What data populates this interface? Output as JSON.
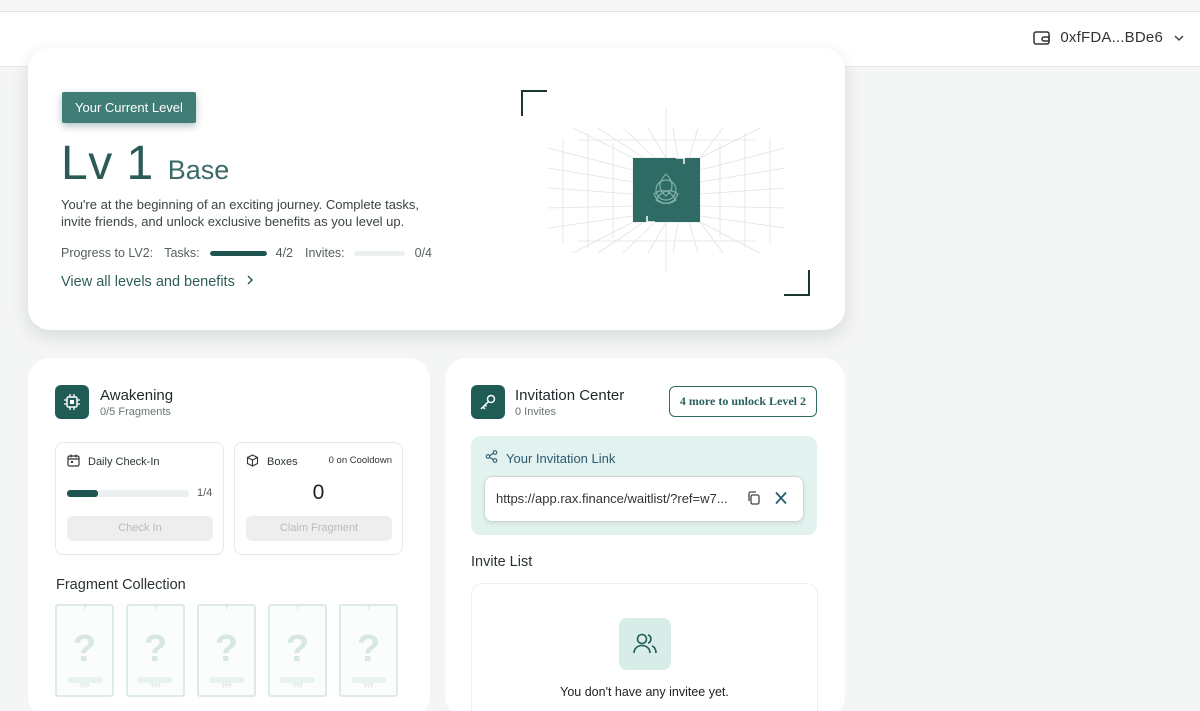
{
  "header": {
    "wallet_address": "0xfFDA...BDe6"
  },
  "level": {
    "badge": "Your Current Level",
    "number": "Lv 1",
    "name": "Base",
    "description": "You're at the beginning of an exciting journey. Complete tasks, invite friends, and unlock exclusive benefits as you level up.",
    "progress_label": "Progress to LV2:",
    "tasks_label": "Tasks:",
    "tasks_value": "4/2",
    "tasks_fraction": 1.0,
    "invites_label": "Invites:",
    "invites_value": "0/4",
    "invites_fraction": 0.0,
    "view_link": "View all levels and benefits"
  },
  "awakening": {
    "title": "Awakening",
    "subtitle": "0/5 Fragments",
    "checkin": {
      "title": "Daily Check-In",
      "progress": "1/4",
      "fraction": 0.25,
      "button": "Check In"
    },
    "boxes": {
      "title": "Boxes",
      "cooldown": "0 on Cooldown",
      "count": "0",
      "button": "Claim Fragment"
    },
    "fragment_title": "Fragment Collection",
    "fragments": [
      {
        "mark": "?",
        "label": "???"
      },
      {
        "mark": "?",
        "label": "???"
      },
      {
        "mark": "?",
        "label": "???"
      },
      {
        "mark": "?",
        "label": "???"
      },
      {
        "mark": "?",
        "label": "???"
      }
    ]
  },
  "invitation": {
    "title": "Invitation Center",
    "subtitle": "0 Invites",
    "unlock_button": "4 more to unlock Level 2",
    "link_title": "Your Invitation Link",
    "link_url": "https://app.rax.finance/waitlist/?ref=w7...",
    "list_title": "Invite List",
    "empty_text": "You don't have any invitee yet."
  },
  "colors": {
    "accent": "#1f5c55",
    "badge": "#3f7d76",
    "link_box_bg": "#e2f2ef"
  },
  "icons": [
    "wallet-icon",
    "chevron-down-icon",
    "chevron-right-icon",
    "chip-icon",
    "calendar-icon",
    "box-icon",
    "key-icon",
    "share-icon",
    "copy-icon",
    "x-logo-icon",
    "users-icon",
    "triquetra-logo"
  ]
}
